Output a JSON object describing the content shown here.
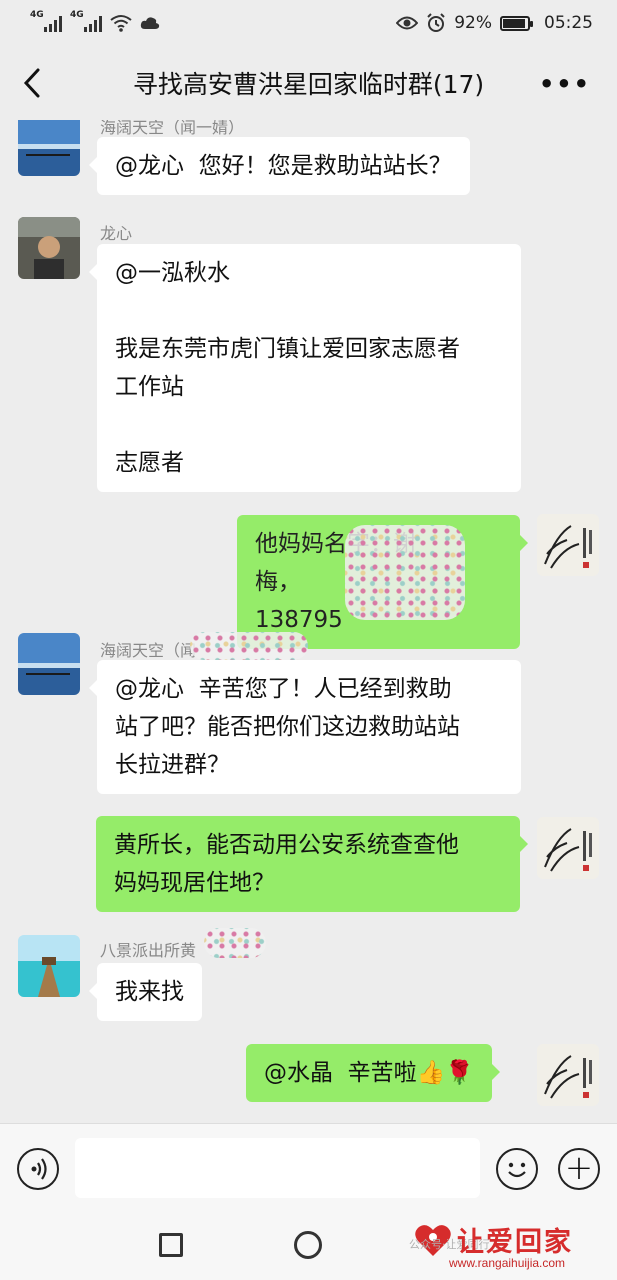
{
  "status_bar": {
    "network1": "4G",
    "network2": "4G",
    "battery_percent": "92%",
    "battery_level": 0.92,
    "time": "05:25"
  },
  "header": {
    "title": "寻找高安曹洪星回家临时群(17)"
  },
  "messages": [
    {
      "sender": "海阔天空（闻一婧）",
      "text": "@龙心  您好！您是救助站站长？"
    },
    {
      "sender": "龙心",
      "text": "@一泓秋水\n\n我是东莞市虎门镇让爱回家志愿者\n工作站\n\n志愿者"
    },
    {
      "sender": "",
      "text": "他妈妈名字：谢      梅，\n138795"
    },
    {
      "sender": "海阔天空（闻",
      "text": "@龙心  辛苦您了！人已经到救助\n站了吧？能否把你们这边救助站站\n长拉进群？"
    },
    {
      "sender": "",
      "text": "黄所长，能否动用公安系统查查他\n妈妈现居住地？"
    },
    {
      "sender": "八景派出所黄",
      "text": "我来找"
    },
    {
      "sender": "",
      "text": "@水晶  辛苦啦👍🌹"
    }
  ],
  "input": {
    "placeholder": ""
  },
  "icons": {
    "back": "back-arrow-icon",
    "more": "more-dots-icon",
    "voice": "voice-icon",
    "emoji": "emoji-icon",
    "plus": "plus-icon",
    "nav_recent": "recent-apps-icon",
    "nav_home": "home-icon"
  },
  "watermark": {
    "brand": "让爱回家",
    "url": "www.rangaihuijia.com",
    "faded": "公众号·让爱同行"
  },
  "colors": {
    "bubble_self": "#95ec69",
    "bubble_other": "#ffffff",
    "background": "#ededed",
    "brand_red": "#d62c2c"
  }
}
